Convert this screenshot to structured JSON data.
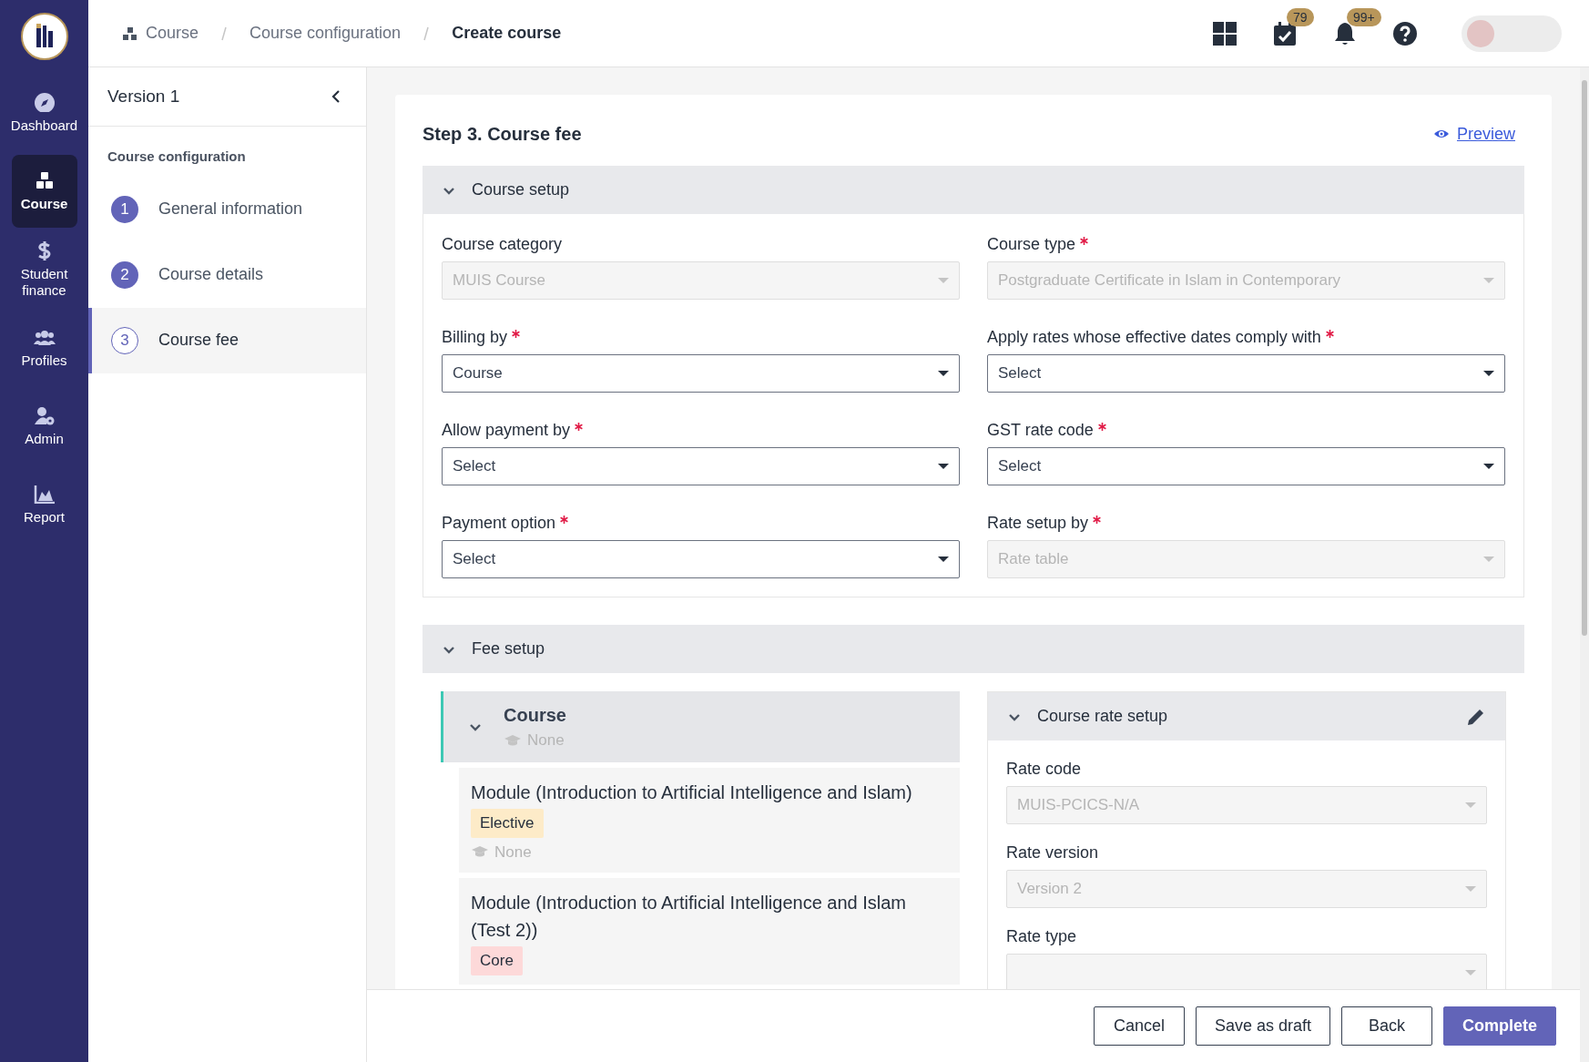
{
  "nav_rail": {
    "items": [
      {
        "kind": "compass",
        "label": "Dashboard",
        "selected": false
      },
      {
        "kind": "boxes",
        "label": "Course",
        "selected": true
      },
      {
        "kind": "dollar",
        "label": "Student finance",
        "selected": false
      },
      {
        "kind": "users",
        "label": "Profiles",
        "selected": false
      },
      {
        "kind": "user-gear",
        "label": "Admin",
        "selected": false
      },
      {
        "kind": "chart",
        "label": "Report",
        "selected": false
      }
    ]
  },
  "breadcrumbs": [
    {
      "label": "Course",
      "current": false
    },
    {
      "label": "Course configuration",
      "current": false
    },
    {
      "label": "Create course",
      "current": true
    }
  ],
  "header_actions": [
    {
      "kind": "apps"
    },
    {
      "kind": "tasks",
      "badge": "79"
    },
    {
      "kind": "notifications",
      "badge": "99+"
    },
    {
      "kind": "help"
    }
  ],
  "steps_panel": {
    "title": "Version 1",
    "section": "Course configuration",
    "steps": [
      {
        "number": "1",
        "label": "General information",
        "selected": false
      },
      {
        "number": "2",
        "label": "Course details",
        "selected": false
      },
      {
        "number": "3",
        "label": "Course fee",
        "selected": true
      }
    ]
  },
  "form": {
    "title": "Step 3. Course fee",
    "preview_link": "Preview",
    "course_setup": {
      "title": "Course setup",
      "expanded": true,
      "fields": [
        {
          "label": "Course category",
          "required": false,
          "value": "MUIS Course",
          "disabled": true
        },
        {
          "label": "Course type",
          "required": true,
          "value": "Postgraduate Certificate in Islam in Contemporary",
          "disabled": true
        },
        {
          "label": "Billing by",
          "required": true,
          "value": "Course",
          "disabled": false
        },
        {
          "label": "Apply rates whose effective dates comply with",
          "required": true,
          "placeholder": "Select",
          "disabled": false
        },
        {
          "label": "Allow payment by",
          "required": true,
          "placeholder": "Select",
          "disabled": false
        },
        {
          "label": "GST rate code",
          "required": true,
          "placeholder": "Select",
          "disabled": false
        },
        {
          "label": "Payment option",
          "required": true,
          "placeholder": "Select",
          "disabled": false
        },
        {
          "label": "Rate setup by",
          "required": true,
          "value": "Rate table",
          "disabled": true
        }
      ]
    },
    "fee_setup": {
      "title": "Fee setup",
      "expanded": true,
      "tree": {
        "title": "Course",
        "expanded": true,
        "instructor": "None",
        "modules": [
          {
            "title": "Module (Introduction to Artificial Intelligence and Islam)",
            "tag": {
              "label": "Elective",
              "color": "#fdebc8"
            },
            "instructor": "None"
          },
          {
            "title": "Module (Introduction to Artificial Intelligence and Islam (Test 2))",
            "tag": {
              "label": "Core",
              "color": "#fdd9d9"
            }
          }
        ]
      },
      "rate_panel": {
        "title": "Course rate setup",
        "expanded": true,
        "fields": [
          {
            "label": "Rate code",
            "value": "MUIS-PCICS-N/A",
            "disabled": true
          },
          {
            "label": "Rate version",
            "value": "Version 2",
            "disabled": true
          },
          {
            "label": "Rate type",
            "disabled": true
          }
        ]
      }
    }
  },
  "footer_buttons": [
    {
      "label": "Cancel",
      "kind": "secondary"
    },
    {
      "label": "Save as draft",
      "kind": "secondary"
    },
    {
      "label": "Back",
      "kind": "secondary"
    },
    {
      "label": "Complete",
      "kind": "primary"
    }
  ]
}
